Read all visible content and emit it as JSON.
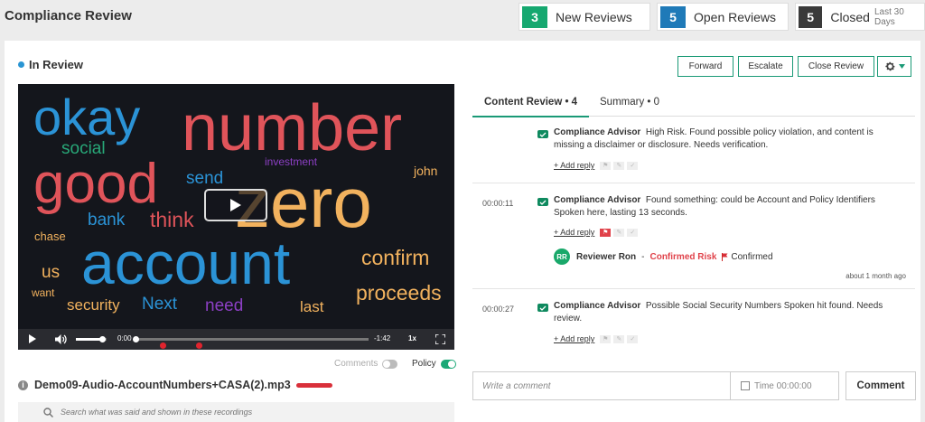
{
  "header": {
    "title": "Compliance Review",
    "stats": [
      {
        "count": "3",
        "label": "New Reviews",
        "sub": "",
        "color": "#16a870"
      },
      {
        "count": "5",
        "label": "Open Reviews",
        "sub": "",
        "color": "#1f7ab8"
      },
      {
        "count": "5",
        "label": "Closed",
        "sub": "Last 30 Days",
        "color": "#3a3a3a"
      }
    ]
  },
  "review": {
    "status": "In Review",
    "buttons": {
      "forward": "Forward",
      "escalate": "Escalate",
      "close": "Close Review"
    }
  },
  "player": {
    "wordcloud": [
      {
        "text": "okay",
        "color": "#2b93d6"
      },
      {
        "text": "number",
        "color": "#e0545a"
      },
      {
        "text": "social",
        "color": "#28a878"
      },
      {
        "text": "investment",
        "color": "#8c3fc4"
      },
      {
        "text": "good",
        "color": "#e0545a"
      },
      {
        "text": "send",
        "color": "#2b93d6"
      },
      {
        "text": "zero",
        "color": "#f2b25e"
      },
      {
        "text": "john",
        "color": "#f2b25e"
      },
      {
        "text": "bank",
        "color": "#2b93d6"
      },
      {
        "text": "think",
        "color": "#e0545a"
      },
      {
        "text": "chase",
        "color": "#f2b25e"
      },
      {
        "text": "account",
        "color": "#2b93d6"
      },
      {
        "text": "confirm",
        "color": "#f2b25e"
      },
      {
        "text": "us",
        "color": "#f2b25e"
      },
      {
        "text": "want",
        "color": "#f2b25e"
      },
      {
        "text": "proceeds",
        "color": "#f2b25e"
      },
      {
        "text": "security",
        "color": "#f2b25e"
      },
      {
        "text": "Next",
        "color": "#2b93d6"
      },
      {
        "text": "need",
        "color": "#8c3fc4"
      },
      {
        "text": "last",
        "color": "#f2b25e"
      }
    ],
    "current_time": "0:00",
    "remaining": "-1:42",
    "speed": "1x",
    "volume": 0.85,
    "progress": 0.0
  },
  "toggles": {
    "comments": "Comments",
    "comments_on": false,
    "policy": "Policy",
    "policy_on": true
  },
  "file": {
    "name": "Demo09-Audio-AccountNumbers+CASA(2).mp3"
  },
  "search": {
    "placeholder": "Search what was said and shown in these recordings"
  },
  "tabs": [
    {
      "label": "Content Review • 4",
      "active": true
    },
    {
      "label": "Summary • 0",
      "active": false
    }
  ],
  "feed": [
    {
      "time": "",
      "author": "Compliance Advisor",
      "text": "High Risk. Found possible policy violation, and content is missing a disclaimer or disclosure. Needs verification.",
      "reply": "+ Add reply"
    },
    {
      "time": "00:00:11",
      "author": "Compliance Advisor",
      "text": "Found something: could be Account and Policy Identifiers Spoken here, lasting 13 seconds.",
      "reply": "+ Add reply",
      "response": {
        "initials": "RR",
        "name": "Reviewer Ron",
        "dash": "-",
        "status": "Confirmed Risk",
        "flag_label": "Confirmed",
        "ago": "about 1 month ago"
      }
    },
    {
      "time": "00:00:27",
      "author": "Compliance Advisor",
      "text": "Possible Social Security Numbers Spoken hit found. Needs review.",
      "reply": "+ Add reply"
    }
  ],
  "comment": {
    "placeholder": "Write a comment",
    "time_label": "Time 00:00:00",
    "button": "Comment"
  }
}
